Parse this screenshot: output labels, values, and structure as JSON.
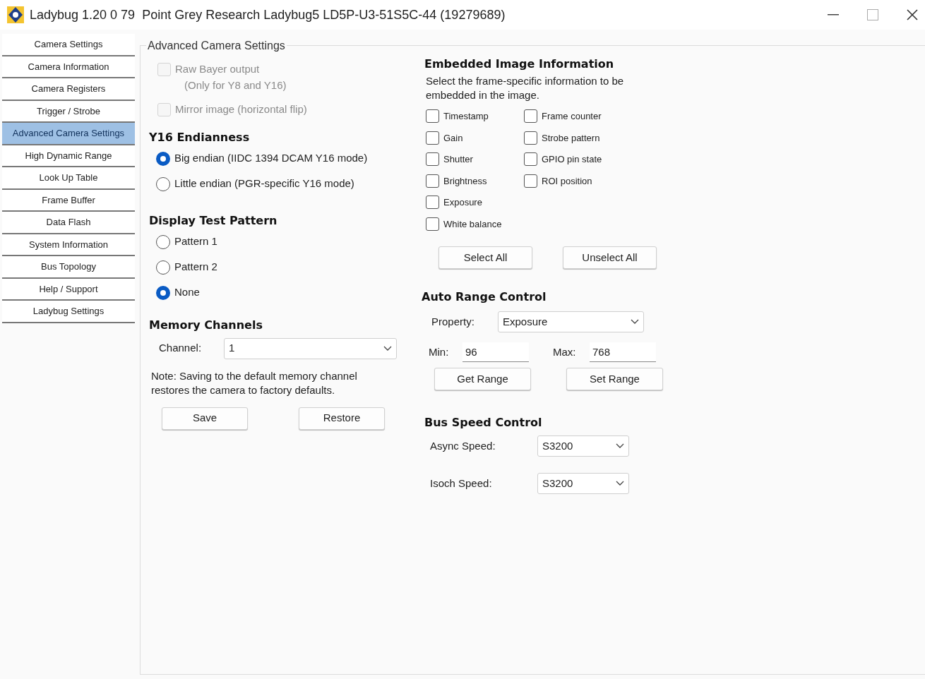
{
  "window": {
    "title": "Ladybug 1.20 0 79  Point Grey Research Ladybug5 LD5P-U3-51S5C-44 (19279689)"
  },
  "sidebar": {
    "items": [
      {
        "label": "Camera Settings",
        "selected": false
      },
      {
        "label": "Camera Information",
        "selected": false
      },
      {
        "label": "Camera Registers",
        "selected": false
      },
      {
        "label": "Trigger / Strobe",
        "selected": false
      },
      {
        "label": "Advanced Camera Settings",
        "selected": true
      },
      {
        "label": "High Dynamic Range",
        "selected": false
      },
      {
        "label": "Look Up Table",
        "selected": false
      },
      {
        "label": "Frame Buffer",
        "selected": false
      },
      {
        "label": "Data Flash",
        "selected": false
      },
      {
        "label": "System Information",
        "selected": false
      },
      {
        "label": "Bus Topology",
        "selected": false
      },
      {
        "label": "Help / Support",
        "selected": false
      },
      {
        "label": "Ladybug Settings",
        "selected": false
      }
    ]
  },
  "panel": {
    "title": "Advanced Camera Settings"
  },
  "options": [
    {
      "label": "Raw Bayer output",
      "sublabel": "(Only for Y8 and Y16)",
      "checked": false,
      "disabled": true
    },
    {
      "label": "Mirror image (horizontal flip)",
      "checked": false,
      "disabled": true
    }
  ],
  "endianness": {
    "title": "Y16 Endianness",
    "options": [
      {
        "label": "Big endian (IIDC 1394 DCAM Y16 mode)",
        "selected": true
      },
      {
        "label": "Little endian (PGR-specific Y16 mode)",
        "selected": false
      }
    ]
  },
  "test_pattern": {
    "title": "Display Test Pattern",
    "options": [
      {
        "label": "Pattern 1",
        "selected": false
      },
      {
        "label": "Pattern 2",
        "selected": false
      },
      {
        "label": "None",
        "selected": true
      }
    ]
  },
  "memory": {
    "title": "Memory Channels",
    "channel_label": "Channel:",
    "channel_value": "1",
    "note": "Note: Saving to the default memory channel restores the camera to factory defaults.",
    "buttons": [
      "Save",
      "Restore"
    ]
  },
  "embedded": {
    "title": "Embedded Image Information",
    "description": "Select the frame-specific information to be embedded in the image.",
    "columns": [
      [
        {
          "label": "Timestamp",
          "checked": false
        },
        {
          "label": "Gain",
          "checked": false
        },
        {
          "label": "Shutter",
          "checked": false
        },
        {
          "label": "Brightness",
          "checked": false
        },
        {
          "label": "Exposure",
          "checked": false
        },
        {
          "label": "White balance",
          "checked": false
        }
      ],
      [
        {
          "label": "Frame counter",
          "checked": false
        },
        {
          "label": "Strobe pattern",
          "checked": false
        },
        {
          "label": "GPIO pin state",
          "checked": false
        },
        {
          "label": "ROI position",
          "checked": false
        }
      ]
    ],
    "buttons": [
      "Select All",
      "Unselect All"
    ]
  },
  "auto_range": {
    "title": "Auto Range Control",
    "property_label": "Property:",
    "property_value": "Exposure",
    "min_label": "Min:",
    "min_value": "96",
    "max_label": "Max:",
    "max_value": "768",
    "buttons": [
      "Get Range",
      "Set Range"
    ]
  },
  "bus_speed": {
    "title": "Bus Speed Control",
    "rows": [
      {
        "label": "Async Speed:",
        "value": "S3200"
      },
      {
        "label": "Isoch Speed:",
        "value": "S3200"
      }
    ]
  }
}
